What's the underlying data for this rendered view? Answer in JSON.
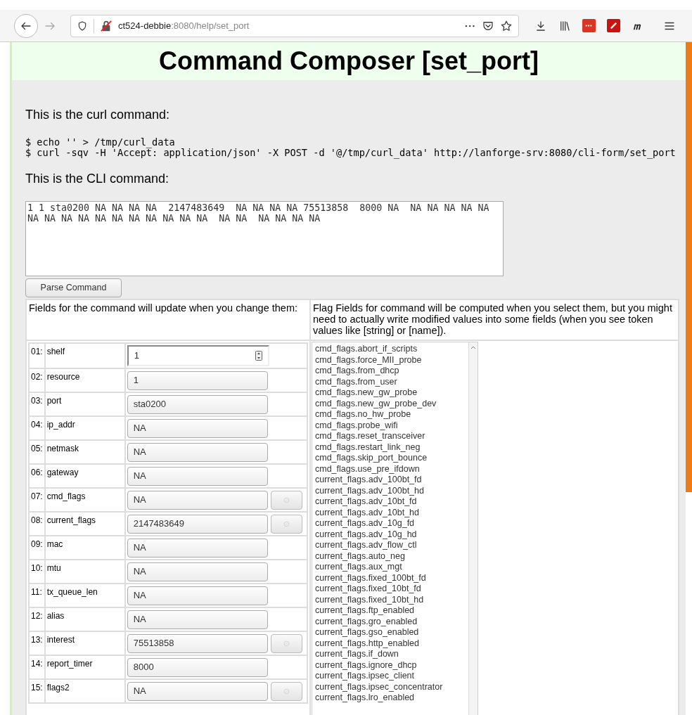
{
  "browser": {
    "url_host": "ct524-debbie",
    "url_rest": ":8080/help/set_port"
  },
  "page": {
    "title": "Command Composer [set_port]",
    "curl_heading": "This is the curl command:",
    "curl_lines": [
      "$ echo '' > /tmp/curl_data",
      "$ curl -sqv -H 'Accept: application/json' -X POST -d '@/tmp/curl_data' http://lanforge-srv:8080/cli-form/set_port"
    ],
    "cli_heading": "This is the CLI command:",
    "cli_text": "1 1 sta0200 NA NA NA NA  2147483649  NA NA NA NA 75513858  8000 NA  NA NA NA NA NA NA NA NA NA NA NA NA NA NA NA NA  NA NA  NA NA NA NA",
    "parse_button": "Parse Command",
    "fields_header": "Fields for the command will update when you change them:",
    "flags_header": "Flag Fields for command will be computed when you select them, but you might need to actually write modified values into some fields (when you see token values like [string] or [name]).",
    "fields": [
      {
        "num": "01:",
        "name": "shelf",
        "value": "1",
        "kind": "number"
      },
      {
        "num": "02:",
        "name": "resource",
        "value": "1",
        "kind": "text"
      },
      {
        "num": "03:",
        "name": "port",
        "value": "sta0200",
        "kind": "text"
      },
      {
        "num": "04:",
        "name": "ip_addr",
        "value": "NA",
        "kind": "text"
      },
      {
        "num": "05:",
        "name": "netmask",
        "value": "NA",
        "kind": "text"
      },
      {
        "num": "06:",
        "name": "gateway",
        "value": "NA",
        "kind": "text"
      },
      {
        "num": "07:",
        "name": "cmd_flags",
        "value": "NA",
        "kind": "flags"
      },
      {
        "num": "08:",
        "name": "current_flags",
        "value": "2147483649",
        "kind": "flags"
      },
      {
        "num": "09:",
        "name": "mac",
        "value": "NA",
        "kind": "text"
      },
      {
        "num": "10:",
        "name": "mtu",
        "value": "NA",
        "kind": "text"
      },
      {
        "num": "11:",
        "name": "tx_queue_len",
        "value": "NA",
        "kind": "text"
      },
      {
        "num": "12:",
        "name": "alias",
        "value": "NA",
        "kind": "text"
      },
      {
        "num": "13:",
        "name": "interest",
        "value": "75513858",
        "kind": "flags"
      },
      {
        "num": "14:",
        "name": "report_timer",
        "value": "8000",
        "kind": "text"
      },
      {
        "num": "15:",
        "name": "flags2",
        "value": "NA",
        "kind": "flags"
      }
    ],
    "flag_options": [
      "cmd_flags.abort_if_scripts",
      "cmd_flags.force_MII_probe",
      "cmd_flags.from_dhcp",
      "cmd_flags.from_user",
      "cmd_flags.new_gw_probe",
      "cmd_flags.new_gw_probe_dev",
      "cmd_flags.no_hw_probe",
      "cmd_flags.probe_wifi",
      "cmd_flags.reset_transceiver",
      "cmd_flags.restart_link_neg",
      "cmd_flags.skip_port_bounce",
      "cmd_flags.use_pre_ifdown",
      "current_flags.adv_100bt_fd",
      "current_flags.adv_100bt_hd",
      "current_flags.adv_10bt_fd",
      "current_flags.adv_10bt_hd",
      "current_flags.adv_10g_fd",
      "current_flags.adv_10g_hd",
      "current_flags.adv_flow_ctl",
      "current_flags.auto_neg",
      "current_flags.aux_mgt",
      "current_flags.fixed_100bt_fd",
      "current_flags.fixed_10bt_fd",
      "current_flags.fixed_10bt_hd",
      "current_flags.ftp_enabled",
      "current_flags.gro_enabled",
      "current_flags.gso_enabled",
      "current_flags.http_enabled",
      "current_flags.if_down",
      "current_flags.ignore_dhcp",
      "current_flags.ipsec_client",
      "current_flags.ipsec_concentrator",
      "current_flags.lro_enabled"
    ]
  }
}
